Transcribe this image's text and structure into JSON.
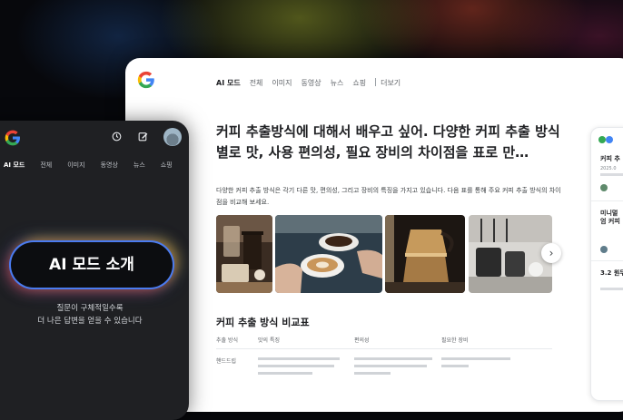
{
  "desktop": {
    "logo": "G",
    "tabs": [
      {
        "label": "AI 모드",
        "active": true
      },
      {
        "label": "전체"
      },
      {
        "label": "이미지"
      },
      {
        "label": "동영상"
      },
      {
        "label": "뉴스"
      },
      {
        "label": "쇼핑"
      },
      {
        "label": "더보기"
      }
    ],
    "query_title": "커피 추출방식에 대해서 배우고 싶어. 다양한 커피 추출 방식별로 맛, 사용 편의성, 필요 장비의 차이점을 표로 만…",
    "answer_text": "다양한 커피 추출 방식은 각기 다른 맛, 편의성, 그리고 장비의 특징을 가지고 있습니다. 다음 표를 통해 주요 커피 추출 방식의 차이점을 비교해 보세요.",
    "photos": [
      "coffee-press-photo",
      "latte-cups-photo",
      "moka-pot-photo",
      "espresso-machine-photo"
    ],
    "next_icon": "chevron-right-icon",
    "table_title": "커피 추출 방식 비교표",
    "table_headers": [
      "추출 방식",
      "맛의 특징",
      "편의성",
      "필요한 장비"
    ],
    "table_rows": [
      {
        "method": "핸드드립"
      }
    ],
    "side_panel": [
      {
        "title": "커피 추",
        "meta": "2025.0"
      },
      {
        "title": "미니멀 엄 커피"
      },
      {
        "title": "3.2 원두"
      }
    ]
  },
  "phone": {
    "logo": "G",
    "history_icon": "history-icon",
    "edit_icon": "edit-icon",
    "tabs": [
      {
        "label": "AI 모드",
        "active": true
      },
      {
        "label": "전체"
      },
      {
        "label": "이미지"
      },
      {
        "label": "동영상"
      },
      {
        "label": "뉴스"
      },
      {
        "label": "쇼핑"
      }
    ],
    "pill_label": "AI 모드 소개",
    "subtitle_line1": "질문이 구체적일수록",
    "subtitle_line2": "더 나은 답변을 얻을 수 있습니다"
  },
  "colors": {
    "google_blue": "#4285F4",
    "google_red": "#EA4335",
    "google_yellow": "#FBBC05",
    "google_green": "#34A853"
  }
}
